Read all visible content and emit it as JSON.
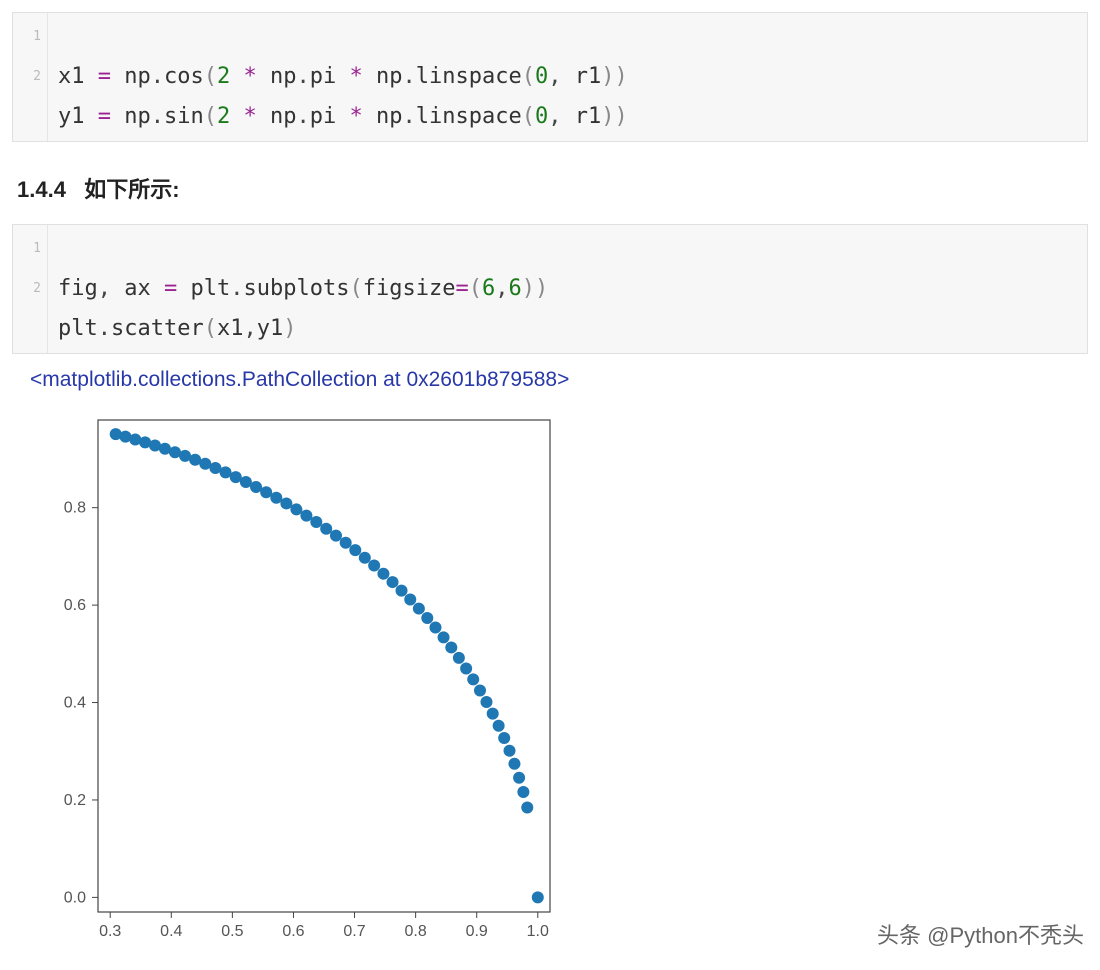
{
  "code1": {
    "lines": [
      "1",
      "2"
    ],
    "l1": {
      "v": "x1",
      "eq": " = ",
      "np1": "np",
      "dot1": ".",
      "fn1": "cos",
      "lp": "(",
      "n2": "2",
      " s1": " ",
      "star1": "*",
      " s2": " ",
      "np2": "np",
      "dot2": ".",
      "pi": "pi",
      " s3": " ",
      "star2": "*",
      " s4": " ",
      "np3": "np",
      "dot3": ".",
      "ls": "linspace",
      "lp2": "(",
      "z": "0",
      "comma": ", ",
      "r": "r1",
      "rp2": ")",
      "rp": ")"
    },
    "l2": {
      "v": "y1",
      "eq": " = ",
      "np1": "np",
      "dot1": ".",
      "fn1": "sin",
      "lp": "(",
      "n2": "2",
      " s1": " ",
      "star1": "*",
      " s2": " ",
      "np2": "np",
      "dot2": ".",
      "pi": "pi",
      " s3": " ",
      "star2": "*",
      " s4": " ",
      "np3": "np",
      "dot3": ".",
      "ls": "linspace",
      "lp2": "(",
      "z": "0",
      "comma": ", ",
      "r": "r1",
      "rp2": ")",
      "rp": ")"
    }
  },
  "heading": {
    "num": "1.4.4",
    "text": "如下所示:"
  },
  "code2": {
    "lines": [
      "1",
      "2"
    ],
    "l1": {
      "fig": "fig",
      "c1": ", ",
      "ax": "ax",
      "eq": " = ",
      "plt": "plt",
      "dot": ".",
      "sub": "subplots",
      "lp": "(",
      "fs": "figsize",
      "eq2": "=",
      "lp2": "(",
      "n1": "6",
      "c2": ",",
      "n2": "6",
      "rp2": ")",
      "rp": ")"
    },
    "l2": {
      "plt": "plt",
      "dot": ".",
      "sc": "scatter",
      "lp": "(",
      "x": "x1",
      "c": ",",
      "y": "y1",
      "rp": ")"
    }
  },
  "output_repr": "<matplotlib.collections.PathCollection at 0x2601b879588>",
  "watermark": "头条 @Python不秃头",
  "chart_data": {
    "type": "scatter",
    "x_ticks": [
      0.3,
      0.4,
      0.5,
      0.6,
      0.7,
      0.8,
      0.9,
      1.0
    ],
    "y_ticks": [
      0.0,
      0.2,
      0.4,
      0.6,
      0.8
    ],
    "xlim": [
      0.28,
      1.02
    ],
    "ylim": [
      -0.03,
      0.98
    ],
    "n_points": 50,
    "x": [
      0.309,
      0.3249,
      0.341,
      0.3571,
      0.3733,
      0.3896,
      0.406,
      0.4225,
      0.439,
      0.4556,
      0.4722,
      0.4888,
      0.5055,
      0.5221,
      0.5387,
      0.5553,
      0.5719,
      0.5884,
      0.6048,
      0.6212,
      0.6374,
      0.6536,
      0.6696,
      0.6855,
      0.7012,
      0.7168,
      0.7321,
      0.7473,
      0.7622,
      0.7769,
      0.7912,
      0.8053,
      0.8191,
      0.8325,
      0.8457,
      0.8584,
      0.8708,
      0.8827,
      0.8943,
      0.9054,
      0.916,
      0.9262,
      0.9359,
      0.945,
      0.9537,
      0.9618,
      0.9694,
      0.9764,
      0.9828,
      1.0
    ],
    "y": [
      0.9511,
      0.9458,
      0.94,
      0.934,
      0.9277,
      0.9209,
      0.9139,
      0.9064,
      0.8985,
      0.8902,
      0.8815,
      0.8724,
      0.8628,
      0.8528,
      0.8425,
      0.8317,
      0.8204,
      0.8087,
      0.7964,
      0.7836,
      0.7705,
      0.7568,
      0.7426,
      0.728,
      0.7129,
      0.6973,
      0.6812,
      0.6645,
      0.6473,
      0.6297,
      0.6115,
      0.5929,
      0.5736,
      0.554,
      0.5338,
      0.5131,
      0.4917,
      0.4699,
      0.4475,
      0.4246,
      0.4012,
      0.3772,
      0.3524,
      0.3271,
      0.301,
      0.2743,
      0.2457,
      0.2164,
      0.1846,
      0.0
    ],
    "marker_color": "#1f77b4"
  }
}
